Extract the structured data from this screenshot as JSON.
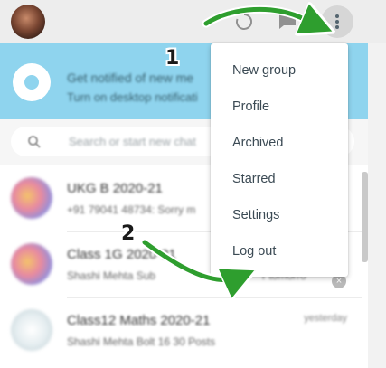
{
  "header": {
    "icons": [
      "avatar",
      "refresh-icon",
      "new-chat-icon",
      "menu-kebab-icon"
    ]
  },
  "notification": {
    "title": "Get notified of new me",
    "subtitle": "Turn on desktop notificati"
  },
  "search": {
    "placeholder": "Search or start new chat"
  },
  "chats": [
    {
      "name": "UKG B 2020-21",
      "preview": "+91 79041 48734: Sorry m",
      "time": ""
    },
    {
      "name": "Class 1G 2020-21",
      "preview": "Shashi Mehta Sub",
      "preview_tail": "r tomorro",
      "time": ""
    },
    {
      "name": "Class12 Maths 2020-21",
      "preview": "Shashi Mehta Bolt 16 30 Posts",
      "time": "yesterday"
    }
  ],
  "menu": {
    "items": [
      "New group",
      "Profile",
      "Archived",
      "Starred",
      "Settings",
      "Log out"
    ]
  },
  "callouts": {
    "step1": "1",
    "step2": "2"
  },
  "colors": {
    "header_bg": "#ededed",
    "notification_bg": "#8fd4ee",
    "arrow_green": "#2e9e2e",
    "menu_text": "#3b4a54"
  }
}
